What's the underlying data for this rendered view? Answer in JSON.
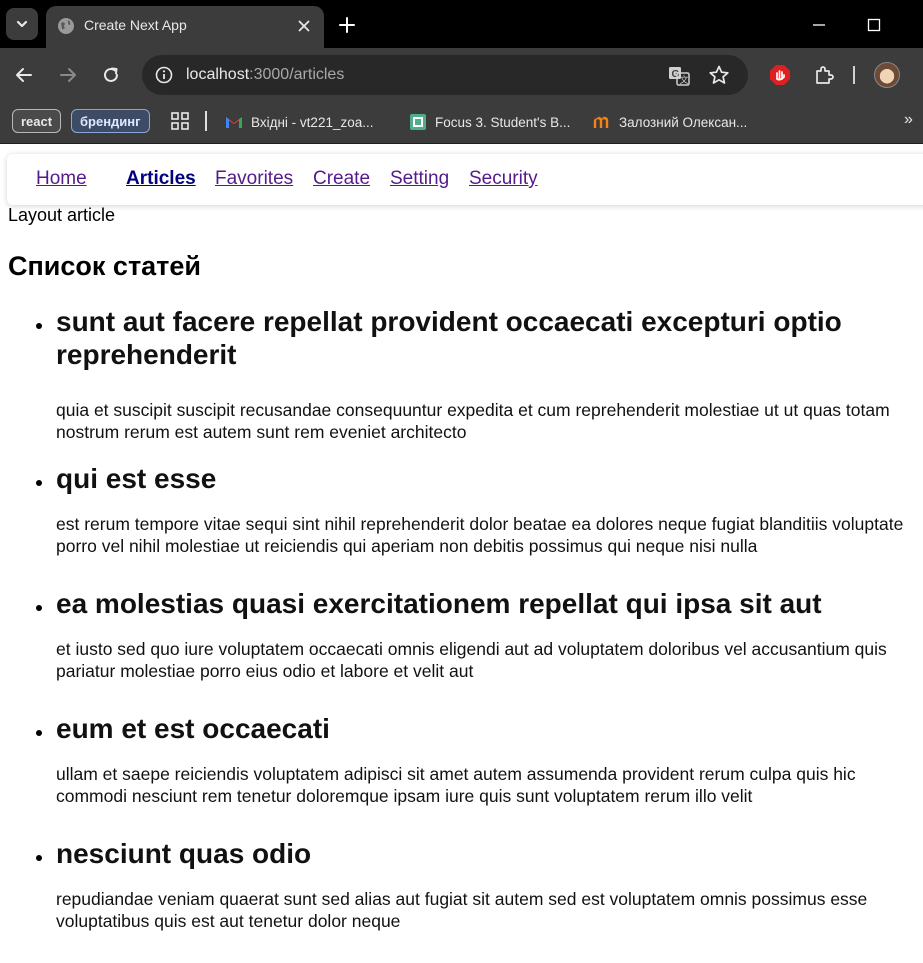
{
  "browser": {
    "tab_title": "Create Next App",
    "url_host": "localhost",
    "url_path": ":3000/articles",
    "bookmarks": {
      "chips": [
        "react",
        "брендинг"
      ],
      "links": [
        "Вхідні - vt221_zoa...",
        "Focus 3. Student's B...",
        "Залозний Олексан..."
      ]
    },
    "icons": [
      "tab-search-icon",
      "globe-icon",
      "close-icon",
      "plus-icon",
      "minimize-icon",
      "maximize-icon",
      "back-icon",
      "forward-icon",
      "reload-icon",
      "info-icon",
      "translate-icon",
      "star-icon",
      "extension-stop-icon",
      "puzzle-icon",
      "avatar",
      "apps-grid-icon",
      "gmail-icon",
      "focus-book-icon",
      "moodle-icon",
      "chevron-double-right-icon"
    ]
  },
  "nav": {
    "items": [
      "Home",
      "Articles",
      "Favorites",
      "Create",
      "Setting",
      "Security"
    ],
    "active": "Articles"
  },
  "layout_text": "Layout article",
  "list_title": "Список статей",
  "articles": [
    {
      "title": "sunt aut facere repellat provident occaecati excepturi optio reprehenderit",
      "body": "quia et suscipit suscipit recusandae consequuntur expedita et cum reprehenderit molestiae ut ut quas totam nostrum rerum est autem sunt rem eveniet architecto"
    },
    {
      "title": "qui est esse",
      "body": "est rerum tempore vitae sequi sint nihil reprehenderit dolor beatae ea dolores neque fugiat blanditiis voluptate porro vel nihil molestiae ut reiciendis qui aperiam non debitis possimus qui neque nisi nulla"
    },
    {
      "title": "ea molestias quasi exercitationem repellat qui ipsa sit aut",
      "body": "et iusto sed quo iure voluptatem occaecati omnis eligendi aut ad voluptatem doloribus vel accusantium quis pariatur molestiae porro eius odio et labore et velit aut"
    },
    {
      "title": "eum et est occaecati",
      "body": "ullam et saepe reiciendis voluptatem adipisci sit amet autem assumenda provident rerum culpa quis hic commodi nesciunt rem tenetur doloremque ipsam iure quis sunt voluptatem rerum illo velit"
    },
    {
      "title": "nesciunt quas odio",
      "body": "repudiandae veniam quaerat sunt sed alias aut fugiat sit autem sed est voluptatem omnis possimus esse voluptatibus quis est aut tenetur dolor neque"
    }
  ],
  "colors": {
    "chrome_dark": "#3c3c3c",
    "tabbar": "#000000",
    "link_visited": "#551a8b",
    "link_active": "#000080"
  }
}
